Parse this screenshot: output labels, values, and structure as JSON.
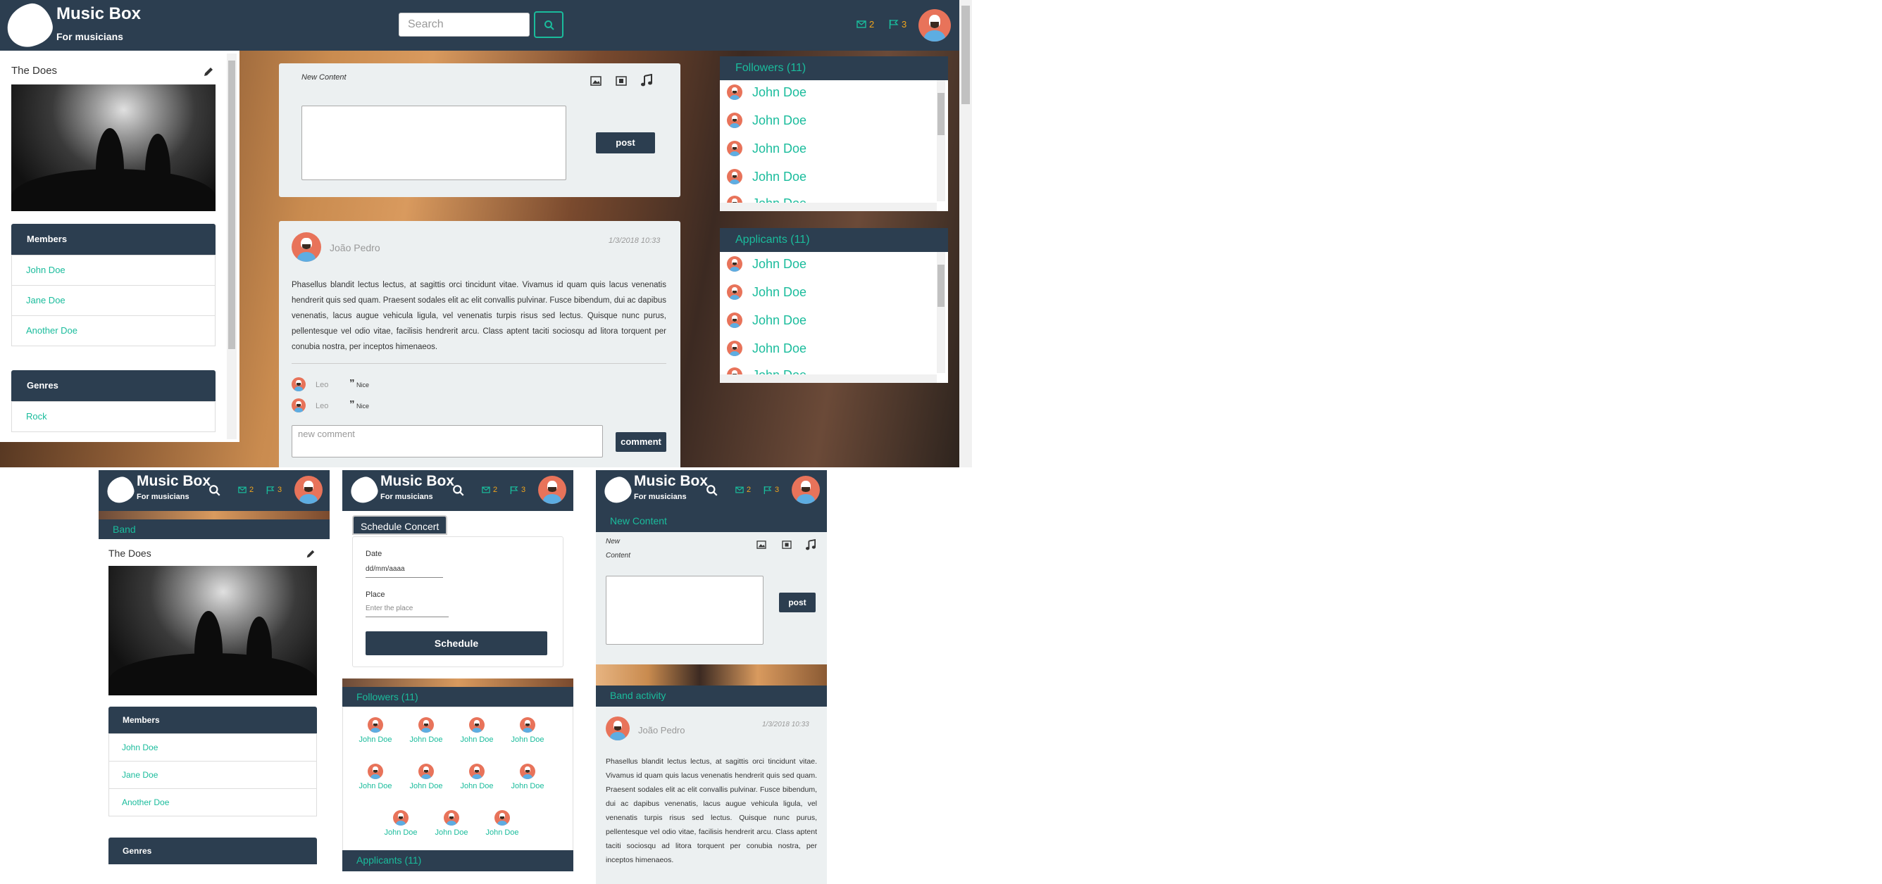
{
  "brand": {
    "title": "Music Box",
    "subtitle": "For musicians"
  },
  "header": {
    "search_placeholder": "Search",
    "messages_count": "2",
    "flags_count": "3"
  },
  "sidebar": {
    "band_name": "The Does",
    "members_title": "Members",
    "members": [
      "John Doe",
      "Jane Doe",
      "Another Doe"
    ],
    "genres_title": "Genres",
    "genres": [
      "Rock"
    ]
  },
  "new_content": {
    "title": "New Content",
    "title_line1": "New",
    "title_line2": "Content",
    "post_label": "post"
  },
  "post": {
    "author": "João Pedro",
    "timestamp": "1/3/2018 10:33",
    "body": "Phasellus blandit lectus lectus, at sagittis orci tincidunt vitae. Vivamus id quam quis lacus venenatis hendrerit quis sed quam. Praesent sodales elit ac elit convallis pulvinar. Fusce bibendum, dui ac dapibus venenatis, lacus augue vehicula ligula, vel venenatis turpis risus sed lectus. Quisque nunc purus, pellentesque vel odio vitae, facilisis hendrerit arcu. Class aptent taciti sociosqu ad litora torquent per conubia nostra, per inceptos himenaeos.",
    "comments": [
      {
        "author": "Leo",
        "text": "Nice"
      },
      {
        "author": "Leo",
        "text": "Nice"
      }
    ],
    "comment_placeholder": "new comment",
    "comment_button": "comment"
  },
  "followers": {
    "title": "Followers (11)",
    "names": [
      "John Doe",
      "John Doe",
      "John Doe",
      "John Doe",
      "John Doe"
    ]
  },
  "applicants": {
    "title": "Applicants (11)",
    "names": [
      "John Doe",
      "John Doe",
      "John Doe",
      "John Doe",
      "John Doe"
    ]
  },
  "mobile": {
    "band_section": "Band",
    "schedule": {
      "tab": "Schedule Concert",
      "date_label": "Date",
      "date_placeholder": "dd/mm/aaaa",
      "place_label": "Place",
      "place_placeholder": "Enter the place",
      "button": "Schedule"
    },
    "followers_grid": [
      "John Doe",
      "John Doe",
      "John Doe",
      "John Doe",
      "John Doe",
      "John Doe",
      "John Doe",
      "John Doe",
      "John Doe",
      "John Doe",
      "John Doe"
    ],
    "band_activity": "Band activity"
  },
  "colors": {
    "navy": "#2c3e50",
    "teal": "#1abc9c",
    "orange": "#f1a51c",
    "card": "#ecf0f1"
  },
  "icons": [
    "logo-icon",
    "search-icon",
    "envelope-icon",
    "flag-icon",
    "pencil-icon",
    "image-icon",
    "film-icon",
    "music-icon",
    "quote-icon"
  ]
}
